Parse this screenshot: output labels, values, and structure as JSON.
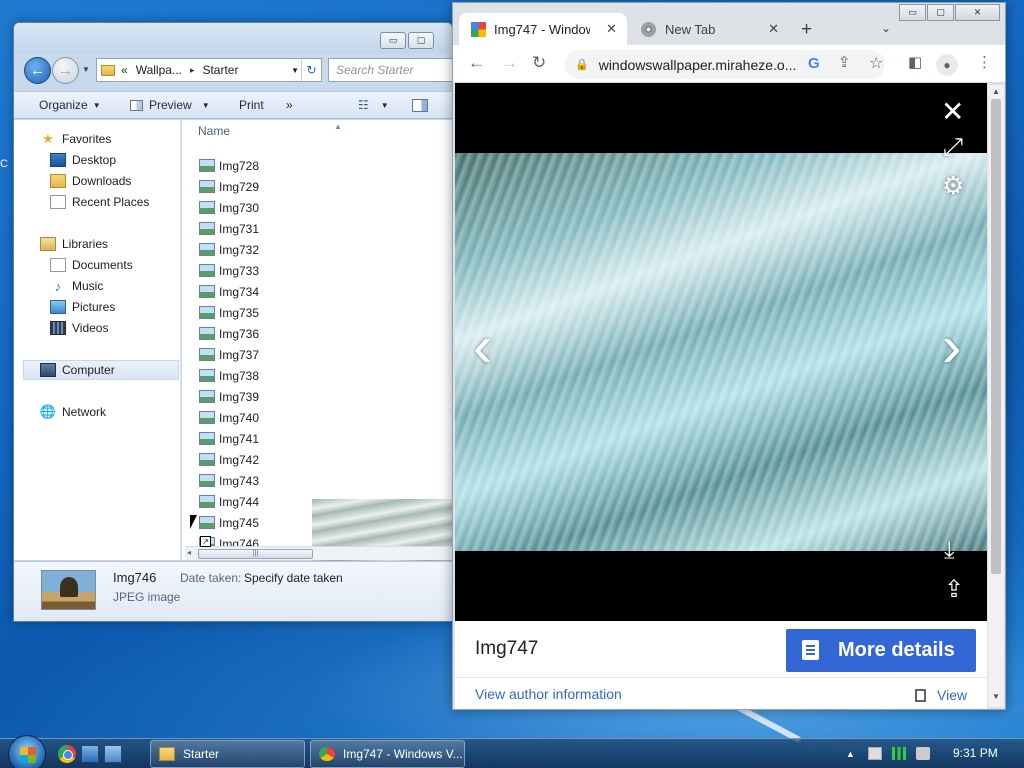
{
  "desktop": {
    "icon_fragment": "C"
  },
  "explorer": {
    "window_buttons": {
      "minimize": "▭",
      "maximize": "▢",
      "close": "✕"
    },
    "address": {
      "overflow": "«",
      "crumbs": [
        "Wallpa...",
        "Starter"
      ],
      "separator": "▸",
      "refresh_glyph": "↻"
    },
    "search_placeholder": "Search Starter",
    "toolbar": {
      "organize": "Organize",
      "preview": "Preview",
      "print": "Print",
      "more": "»"
    },
    "nav": {
      "favorites": "Favorites",
      "desktop": "Desktop",
      "downloads": "Downloads",
      "recent_places": "Recent Places",
      "libraries": "Libraries",
      "documents": "Documents",
      "music": "Music",
      "pictures": "Pictures",
      "videos": "Videos",
      "computer": "Computer",
      "network": "Network"
    },
    "column_header": "Name",
    "files": [
      "Img728",
      "Img729",
      "Img730",
      "Img731",
      "Img732",
      "Img733",
      "Img734",
      "Img735",
      "Img736",
      "Img737",
      "Img738",
      "Img739",
      "Img740",
      "Img741",
      "Img742",
      "Img743",
      "Img744",
      "Img745",
      "Img746"
    ],
    "details": {
      "name": "Img746",
      "type": "JPEG image",
      "date_key": "Date taken:",
      "date_value": "Specify date taken"
    }
  },
  "chrome": {
    "window_buttons": {
      "minimize": "▭",
      "maximize": "▢",
      "close": "✕"
    },
    "tabs": [
      {
        "title": "Img747 - Window",
        "close": "✕"
      },
      {
        "title": "New Tab",
        "close": "✕"
      }
    ],
    "new_tab": "+",
    "tab_search": "⌄",
    "url": "windowswallpaper.miraheze.o...",
    "google_glyph": "G",
    "viewer": {
      "close": "✕",
      "expand": "⤢",
      "settings": "⚙",
      "prev": "‹",
      "next": "›",
      "download": "⤓",
      "share": "⇪"
    },
    "image_title": "Img747",
    "more_details": "More details",
    "author_link": "View author information",
    "view_link": "View"
  },
  "taskbar": {
    "tasks": [
      {
        "label": "Starter"
      },
      {
        "label": "Img747 - Windows V..."
      }
    ],
    "clock": "9:31 PM",
    "tray_arrow": "▲"
  },
  "colors": {
    "chrome_accent": "#3367d6",
    "viewer_background": "#000000"
  }
}
